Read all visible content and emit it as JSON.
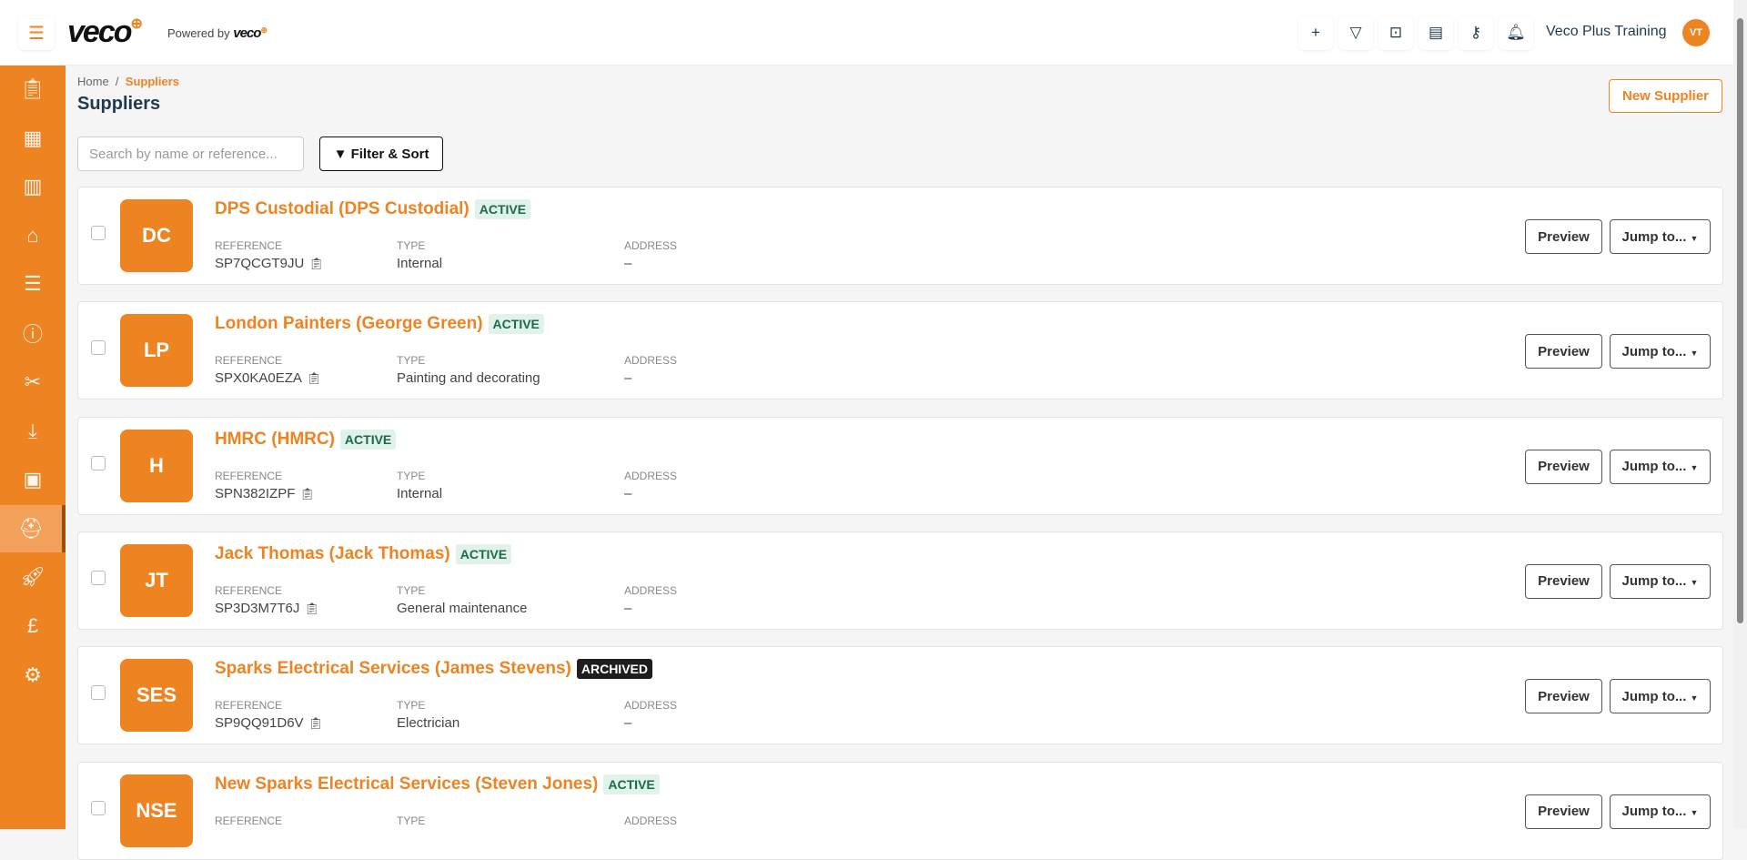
{
  "header": {
    "logo": "veco",
    "powered_by": "Powered by",
    "user_name": "Veco Plus Training",
    "user_initials": "VT",
    "icons": [
      "plus-icon",
      "filter-icon",
      "folder-download-icon",
      "table-icon",
      "key-icon",
      "bell-icon"
    ]
  },
  "sidebar": {
    "items": [
      "clipboard-check",
      "calendar",
      "building",
      "home-user",
      "checklist",
      "alert-chat",
      "tools",
      "download-tray",
      "contact-book",
      "worker",
      "rocket",
      "pound",
      "settings"
    ],
    "active": "worker"
  },
  "breadcrumb": {
    "home": "Home",
    "sep": "/",
    "current": "Suppliers"
  },
  "page_title": "Suppliers",
  "new_supplier": "New Supplier",
  "search": {
    "placeholder": "Search by name or reference...",
    "value": ""
  },
  "filter_sort": "Filter & Sort",
  "labels": {
    "reference": "REFERENCE",
    "type": "TYPE",
    "address": "ADDRESS",
    "preview": "Preview",
    "jump": "Jump to..."
  },
  "suppliers": [
    {
      "initials": "DC",
      "name": "DPS Custodial (DPS Custodial)",
      "status": "ACTIVE",
      "reference": "SP7QCGT9JU",
      "type": "Internal",
      "address": "–"
    },
    {
      "initials": "LP",
      "name": "London Painters (George Green)",
      "status": "ACTIVE",
      "reference": "SPX0KA0EZA",
      "type": "Painting and decorating",
      "address": "–"
    },
    {
      "initials": "H",
      "name": "HMRC (HMRC)",
      "status": "ACTIVE",
      "reference": "SPN382IZPF",
      "type": "Internal",
      "address": "–"
    },
    {
      "initials": "JT",
      "name": "Jack Thomas (Jack Thomas)",
      "status": "ACTIVE",
      "reference": "SP3D3M7T6J",
      "type": "General maintenance",
      "address": "–"
    },
    {
      "initials": "SES",
      "name": "Sparks Electrical Services (James Stevens)",
      "status": "ARCHIVED",
      "reference": "SP9QQ91D6V",
      "type": "Electrician",
      "address": "–"
    },
    {
      "initials": "NSE",
      "name": "New Sparks Electrical Services (Steven Jones)",
      "status": "ACTIVE",
      "reference": "",
      "type": "",
      "address": ""
    }
  ],
  "colors": {
    "brand": "#ee8322",
    "title": "#1f3a4d"
  }
}
